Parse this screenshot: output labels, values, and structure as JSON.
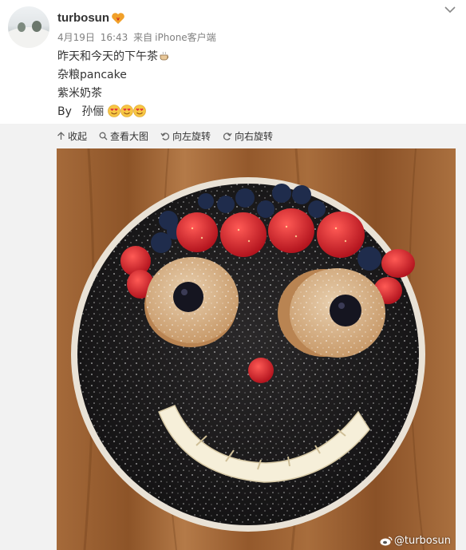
{
  "user": {
    "name": "turbosun",
    "vip_icon": "vip-membership-icon"
  },
  "meta": {
    "date": "4月19日",
    "time": "16:43",
    "from_label": "来自",
    "source": "iPhone客户端"
  },
  "post": {
    "line1": "昨天和今天的下午茶",
    "line1_icon": "tea-cup-emoji",
    "line2": "杂粮pancake",
    "line3": "紫米奶茶",
    "byline_prefix": "By",
    "byline_author": "孙俪",
    "byline_emojis": [
      "heart-eyes-emoji",
      "heart-eyes-emoji",
      "heart-eyes-emoji"
    ]
  },
  "toolbar": {
    "collapse": "收起",
    "view_large": "查看大图",
    "rotate_left": "向左旋转",
    "rotate_right": "向右旋转"
  },
  "image": {
    "description_icon": "pancake-smiley-face-plate",
    "watermark": "@turbosun"
  },
  "colors": {
    "username": "#333333",
    "meta": "#808080",
    "toolbar_bg": "#f2f2f2",
    "plate_dark": "#1c1b1c",
    "strawberry": "#d4222a",
    "blueberry": "#1f2c4c"
  }
}
